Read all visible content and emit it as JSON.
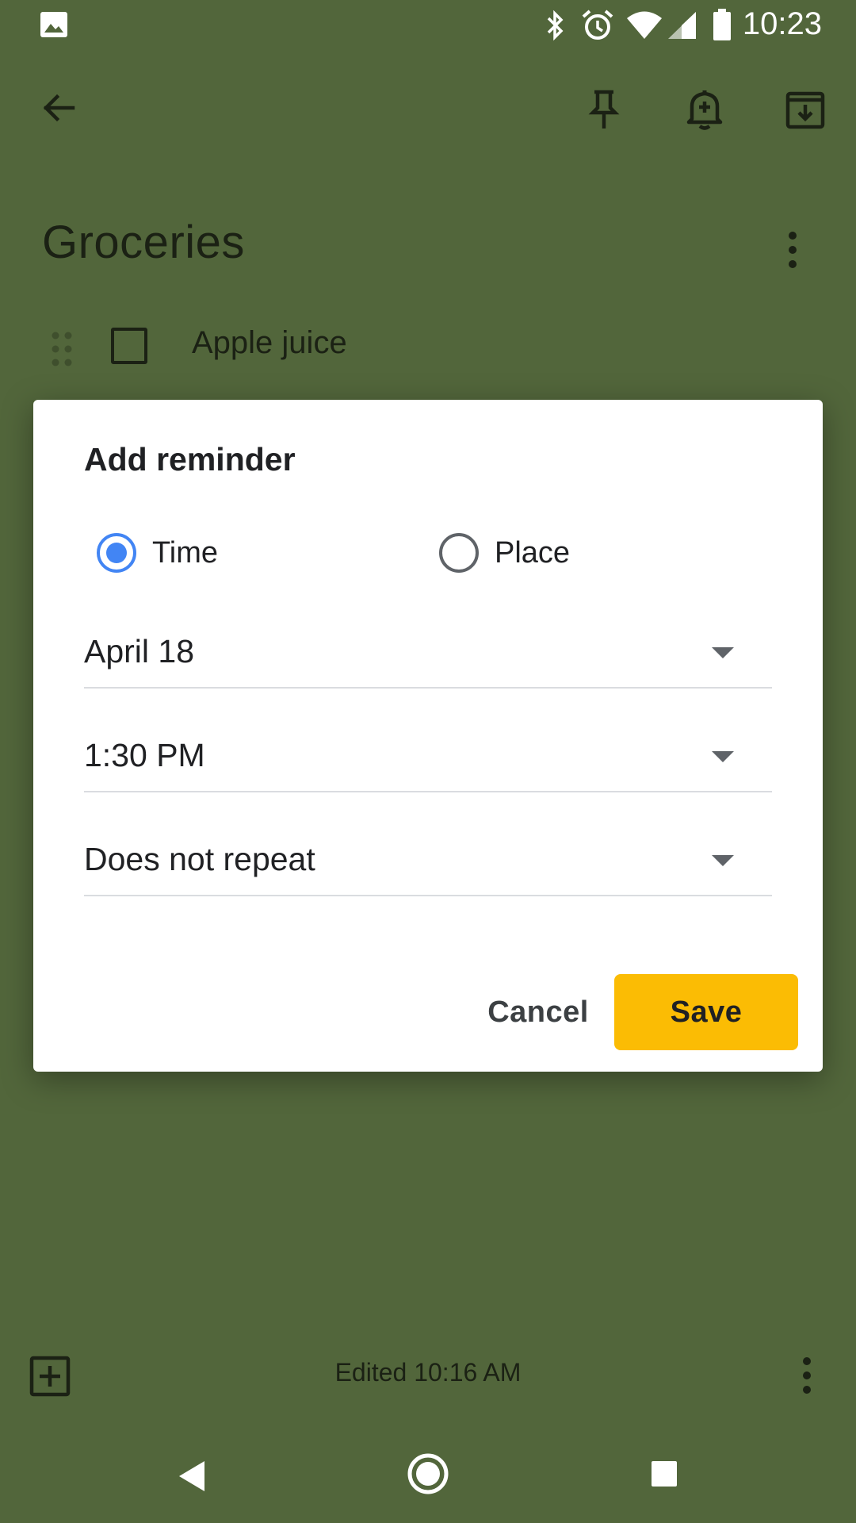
{
  "status_bar": {
    "time": "10:23",
    "icons": [
      "image-icon",
      "bluetooth-icon",
      "alarm-icon",
      "wifi-icon",
      "signal-icon",
      "battery-icon"
    ]
  },
  "app_bar": {
    "icons": [
      "back-arrow-icon",
      "pin-icon",
      "reminder-bell-icon",
      "archive-icon"
    ]
  },
  "note": {
    "title": "Groceries",
    "items": [
      {
        "text": "Apple juice",
        "checked": false
      }
    ],
    "edited": "Edited 10:16 AM"
  },
  "dialog": {
    "title": "Add reminder",
    "options": [
      {
        "label": "Time",
        "selected": true
      },
      {
        "label": "Place",
        "selected": false
      }
    ],
    "date": "April 18",
    "time": "1:30 PM",
    "repeat": "Does not repeat",
    "cancel_label": "Cancel",
    "save_label": "Save"
  },
  "colors": {
    "background": "#52663b",
    "accent_radio": "#4285f4",
    "save_button": "#fbbc04"
  }
}
